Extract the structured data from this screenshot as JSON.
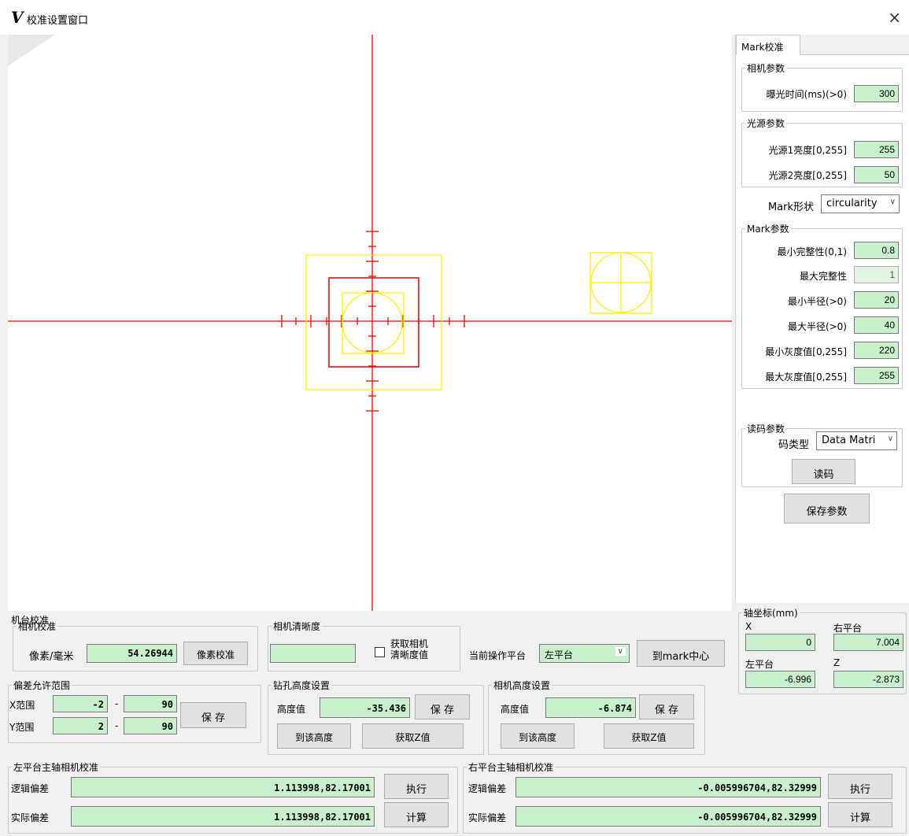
{
  "window": {
    "logo": "V",
    "title": "校准设置窗口",
    "close": "×"
  },
  "right_panel": {
    "tab": "Mark校准",
    "camera_params": {
      "legend": "相机参数",
      "exposure_label": "曝光时间(ms)(>0)",
      "exposure_value": "300"
    },
    "light_params": {
      "legend": "光源参数",
      "light1_label": "光源1亮度[0,255]",
      "light1_value": "255",
      "light2_label": "光源2亮度[0,255]",
      "light2_value": "50"
    },
    "mark_shape": {
      "label": "Mark形状",
      "value": "circularity"
    },
    "mark_params": {
      "legend": "Mark参数",
      "rows": [
        {
          "label": "最小完整性(0,1)",
          "value": "0.8"
        },
        {
          "label": "最大完整性",
          "value": "1"
        },
        {
          "label": "最小半径(>0)",
          "value": "20"
        },
        {
          "label": "最大半径(>0)",
          "value": "40"
        },
        {
          "label": "最小灰度值[0,255]",
          "value": "220"
        },
        {
          "label": "最大灰度值[0,255]",
          "value": "255"
        }
      ]
    },
    "code_params": {
      "legend": "读码参数",
      "type_label": "码类型",
      "type_value": "Data Matri",
      "read_button": "读码"
    },
    "save_params_button": "保存参数"
  },
  "axis": {
    "legend": "轴坐标(mm)",
    "x_label": "X",
    "x_value": "0",
    "right_label": "右平台",
    "right_value": "7.004",
    "left_label": "左平台",
    "left_value": "-6.996",
    "z_label": "Z",
    "z_value": "-2.873"
  },
  "machine_calib": {
    "title": "机台校准",
    "camera_calib": {
      "legend": "相机校准",
      "pixel_label": "像素/毫米",
      "pixel_value": "54.26944",
      "button": "像素校准"
    },
    "clarity": {
      "legend": "相机清晰度",
      "value": "",
      "checkbox_label_1": "获取相机",
      "checkbox_label_2": "清晰度值"
    },
    "platform": {
      "label": "当前操作平台",
      "value": "左平台",
      "button": "到mark中心"
    }
  },
  "deviation": {
    "legend": "偏差允许范围",
    "x_label": "X范围",
    "x_min": "-2",
    "x_max": "90",
    "y_label": "Y范围",
    "y_min": "2",
    "y_max": "90",
    "dash": "-",
    "save": "保 存"
  },
  "drill_height": {
    "legend": "钻孔高度设置",
    "label": "高度值",
    "value": "-35.436",
    "save": "保 存",
    "goto": "到该高度",
    "getz": "获取Z值"
  },
  "camera_height": {
    "legend": "相机高度设置",
    "label": "高度值",
    "value": "-6.874",
    "save": "保 存",
    "goto": "到该高度",
    "getz": "获取Z值"
  },
  "left_spindle": {
    "legend": "左平台主轴相机校准",
    "logic_label": "逻辑偏差",
    "logic_value": "1.113998,82.17001",
    "actual_label": "实际偏差",
    "actual_value": "1.113998,82.17001",
    "exec": "执行",
    "calc": "计算"
  },
  "right_spindle": {
    "legend": "右平台主轴相机校准",
    "logic_label": "逻辑偏差",
    "logic_value": "-0.005996704,82.32999",
    "actual_label": "实际偏差",
    "actual_value": "-0.005996704,82.32999",
    "exec": "执行",
    "calc": "计算"
  },
  "colors": {
    "crosshair": "#ff0000",
    "mark": "#ffff00",
    "field_bg": "#c8f0cc"
  }
}
